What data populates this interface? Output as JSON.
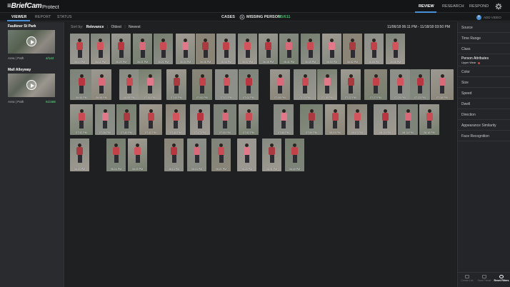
{
  "header": {
    "logo": "BriefCam",
    "product": "Protect",
    "nav": [
      "REVIEW",
      "RESEARCH",
      "RESPOND"
    ]
  },
  "tabs": [
    "VIEWER",
    "REPORT",
    "STATUS"
  ],
  "case": {
    "label": "CASES",
    "name": "MISSING PERSON",
    "count": "55/611"
  },
  "add_video": "ADD VIDEO",
  "cameras": [
    {
      "title": "Faulkner St Park",
      "mode": "Area | Path",
      "count": "4/143"
    },
    {
      "title": "Mall Alleyway",
      "mode": "Area | Path",
      "count": "51/468"
    }
  ],
  "sort": {
    "label": "Sort by:",
    "options": [
      "Relevance",
      "Oldest",
      "Newest"
    ]
  },
  "date_range": "11/06/18 06:11 PM - 11/18/18 03:50 PM",
  "results": {
    "rows": [
      [
        "06:10 PM",
        "06:11 PM",
        "06:20 PM",
        "06:21 PM",
        "06:21 PM",
        "06:34 PM",
        "06:36 PM",
        "06:36 PM",
        "06:37 PM",
        "06:38 PM",
        "06:41 PM",
        "06:49 PM",
        "06:50 PM",
        "06:52 PM",
        "06:58 PM",
        "06:58 PM"
      ],
      [
        "06:55 PM",
        "06:58 PM",
        "06:59 PM",
        "07:00 PM",
        "07:00 PM",
        "07:00 PM",
        "07:01 PM",
        "07:04 PM",
        "07:08 PM",
        "07:11 PM",
        "07:15 PM",
        "07:22 PM",
        "07:27 PM",
        "07:29 PM",
        "07:33 PM",
        "07:38 PM"
      ],
      [
        "07:32 PM",
        "07:36 PM",
        "07:40 PM",
        "07:42 PM",
        "07:45 PM",
        "07:47 PM",
        "07:50 PM",
        "07:52 PM",
        "07:55 PM",
        "07:59 PM",
        "08:03 PM",
        "08:07 PM",
        "08:10 PM",
        "08:14 PM",
        "08:18 PM"
      ],
      [
        "06:03 PM",
        "06:04 PM",
        "06:09 PM",
        "06:13 PM",
        "06:16 PM",
        "06:21 PM",
        "06:26 PM",
        "06:31 PM",
        "06:40 PM"
      ]
    ]
  },
  "filters": [
    "Source",
    "Time Range",
    "Class",
    "Person Attributes",
    "Color",
    "Size",
    "Speed",
    "Dwell",
    "Direction",
    "Appearance Similarity",
    "Face Recognition"
  ],
  "person_attr_sub": "Upper Wear",
  "actions": [
    "Create List",
    "Save Preset",
    "Reset Filters"
  ],
  "colors": {
    "accent": "#4a90d9",
    "count_green": "#44b86b"
  },
  "icons": {
    "gear": "gear-icon",
    "cases": "cases-icon",
    "play": "play-icon",
    "add_video": "plus-icon"
  }
}
